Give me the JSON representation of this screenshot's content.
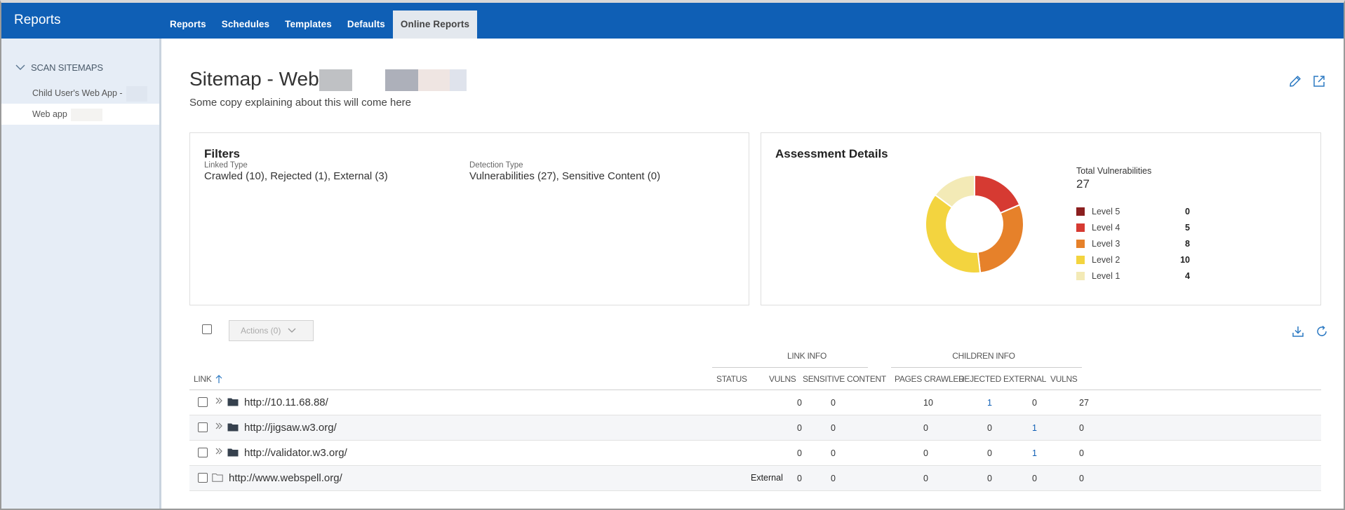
{
  "app": {
    "title": "Reports"
  },
  "tabs": [
    {
      "label": "Reports",
      "active": false
    },
    {
      "label": "Schedules",
      "active": false
    },
    {
      "label": "Templates",
      "active": false
    },
    {
      "label": "Defaults",
      "active": false
    },
    {
      "label": "Online Reports",
      "active": true
    }
  ],
  "sidebar": {
    "section": "SCAN SITEMAPS",
    "items": [
      {
        "label": "Child User's Web App -",
        "selected": false
      },
      {
        "label": "Web app",
        "selected": true
      }
    ]
  },
  "page": {
    "title": "Sitemap - Web",
    "subtitle": "Some copy explaining about this will come here"
  },
  "filters": {
    "title": "Filters",
    "linked_type_label": "Linked Type",
    "linked_type_value": "Crawled (10),  Rejected (1),  External (3)",
    "detection_type_label": "Detection Type",
    "detection_type_value": "Vulnerabilities (27), Sensitive Content (0)"
  },
  "assessment": {
    "title": "Assessment Details",
    "total_label": "Total Vulnerabilities",
    "total_value": "27",
    "levels": [
      {
        "name": "Level 5",
        "value": 0,
        "color": "#8b1f1f"
      },
      {
        "name": "Level 4",
        "value": 5,
        "color": "#d63a32"
      },
      {
        "name": "Level 3",
        "value": 8,
        "color": "#e6812a"
      },
      {
        "name": "Level 2",
        "value": 10,
        "color": "#f3d43f"
      },
      {
        "name": "Level 1",
        "value": 4,
        "color": "#f3eab6"
      }
    ]
  },
  "toolbar": {
    "actions_label": "Actions (0)"
  },
  "table": {
    "group_link_info": "LINK INFO",
    "group_children_info": "CHILDREN INFO",
    "headers": {
      "link": "LINK",
      "status": "STATUS",
      "vulns": "VULNS",
      "sensitive": "SENSITIVE CONTENT",
      "pages_crawled": "PAGES CRAWLED",
      "rejected": "REJECTED",
      "external": "EXTERNAL",
      "child_vulns": "VULNS"
    },
    "rows": [
      {
        "link": "http://10.11.68.88/",
        "status": "",
        "vulns": "0",
        "sensitive": "0",
        "pages_crawled": "10",
        "rejected": "1",
        "external": "0",
        "child_vulns": "27",
        "expandable": true
      },
      {
        "link": "http://jigsaw.w3.org/",
        "status": "",
        "vulns": "0",
        "sensitive": "0",
        "pages_crawled": "0",
        "rejected": "0",
        "external": "1",
        "child_vulns": "0",
        "expandable": true
      },
      {
        "link": "http://validator.w3.org/",
        "status": "",
        "vulns": "0",
        "sensitive": "0",
        "pages_crawled": "0",
        "rejected": "0",
        "external": "1",
        "child_vulns": "0",
        "expandable": true
      },
      {
        "link": "http://www.webspell.org/",
        "status": "External",
        "vulns": "0",
        "sensitive": "0",
        "pages_crawled": "0",
        "rejected": "0",
        "external": "0",
        "child_vulns": "0",
        "expandable": false
      }
    ]
  },
  "colors": {
    "brand": "#0f5fb5",
    "link_accent": "#0f5fb5"
  }
}
